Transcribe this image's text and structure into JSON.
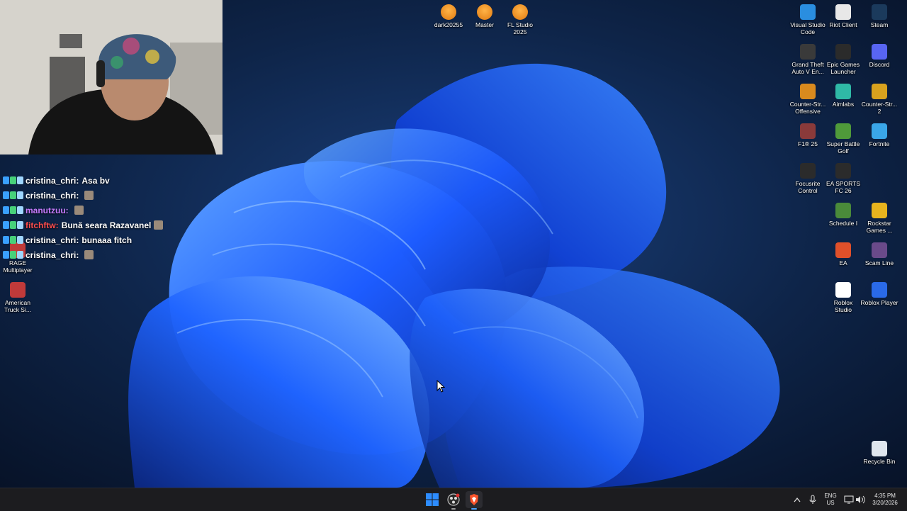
{
  "top_icons": [
    {
      "label": "dark20255",
      "icon": "fl-studio-icon"
    },
    {
      "label": "Master",
      "icon": "fl-studio-icon"
    },
    {
      "label": "FL Studio\n2025",
      "icon": "fl-studio-icon"
    }
  ],
  "right_icons": [
    {
      "label": "Visual Studio\nCode",
      "icon": "vscode-icon",
      "color": "#2a8ee0"
    },
    {
      "label": "Riot Client",
      "icon": "file-icon",
      "color": "#e8e8e8"
    },
    {
      "label": "Steam",
      "icon": "steam-icon",
      "color": "#1b3a5c"
    },
    {
      "label": "Grand Theft\nAuto V En...",
      "icon": "gta-icon",
      "color": "#3a3a3a"
    },
    {
      "label": "Epic Games\nLauncher",
      "icon": "epic-games-icon",
      "color": "#2b2b2b"
    },
    {
      "label": "Discord",
      "icon": "discord-icon",
      "color": "#5865f2"
    },
    {
      "label": "Counter-Str...\nOffensive",
      "icon": "csgo-icon",
      "color": "#d98a1e"
    },
    {
      "label": "Aimlabs",
      "icon": "aimlabs-icon",
      "color": "#2fb9a6"
    },
    {
      "label": "Counter-Str...\n2",
      "icon": "cs2-icon",
      "color": "#d9a21e"
    },
    {
      "label": "F1® 25",
      "icon": "f1-icon",
      "color": "#8a3a3a"
    },
    {
      "label": "Super Battle\nGolf",
      "icon": "golf-icon",
      "color": "#4f9a3a"
    },
    {
      "label": "Fortnite",
      "icon": "fortnite-icon",
      "color": "#3aa6e8"
    },
    {
      "label": "Focusrite\nControl",
      "icon": "focusrite-icon",
      "color": "#2b2b2b"
    },
    {
      "label": "EA SPORTS\nFC 26",
      "icon": "ea-fc-icon",
      "color": "#2b2b2b"
    },
    {
      "label": "Schedule I",
      "icon": "schedule-icon",
      "color": "#4a8a3a"
    },
    {
      "label": "Rockstar\nGames ...",
      "icon": "rockstar-icon",
      "color": "#e8b41e"
    },
    {
      "label": "EA",
      "icon": "ea-icon",
      "color": "#e0502a"
    },
    {
      "label": "Scam Line",
      "icon": "scam-line-icon",
      "color": "#6a4a8a"
    },
    {
      "label": "Roblox\nStudio",
      "icon": "roblox-studio-icon",
      "color": "#ffffff"
    },
    {
      "label": "Roblox Player",
      "icon": "roblox-player-icon",
      "color": "#2a6ae8"
    },
    {
      "label": "Recycle Bin",
      "icon": "recycle-bin-icon",
      "color": "#dfe6ee"
    }
  ],
  "left_icons": [
    {
      "label": "RAGE\nMultiplayer",
      "icon": "rage-mp-icon"
    },
    {
      "label": "American\nTruck Si...",
      "icon": "ats-icon"
    }
  ],
  "chat": [
    {
      "user": "cristina_chri:",
      "message": "Asa bv",
      "user_color": "#ffffff",
      "emote": false
    },
    {
      "user": "cristina_chri:",
      "message": "",
      "user_color": "#ffffff",
      "emote": true
    },
    {
      "user": "manutzuu:",
      "message": "",
      "user_color": "#c87bff",
      "emote": true
    },
    {
      "user": "fitchftw:",
      "message": "Bună seara Razavanel",
      "user_color": "#ff4d4d",
      "emote": true
    },
    {
      "user": "cristina_chri:",
      "message": "bunaaa fitch",
      "user_color": "#ffffff",
      "emote": false
    },
    {
      "user": "cristina_chri:",
      "message": "",
      "user_color": "#ffffff",
      "emote": true
    }
  ],
  "taskbar": {
    "lang": "ENG",
    "region": "US",
    "time": "4:35 PM",
    "date": "3/20/2026",
    "accent": "#2d8cff"
  },
  "colors": {
    "wallpaper_dark": "#0a1a3a",
    "wallpaper_blue": "#1e5cff"
  }
}
